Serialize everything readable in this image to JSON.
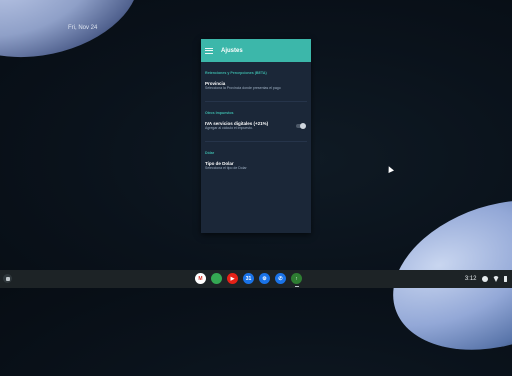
{
  "desktop": {
    "date": "Fri, Nov 24"
  },
  "app": {
    "title": "Ajustes",
    "sections": [
      {
        "header": "Retenciones y Percepciones (BETA)",
        "items": [
          {
            "title": "Provincia",
            "subtitle": "Selecciona la Provincia donde presentas el pago"
          }
        ]
      },
      {
        "header": "Otros Impuestos",
        "items": [
          {
            "title": "IVA servicios digitales (+21%)",
            "subtitle": "Agregar al cálculo el impuesto.",
            "toggle": false
          }
        ]
      },
      {
        "header": "Dólar",
        "items": [
          {
            "title": "Tipo de Dolar",
            "subtitle": "Selecciona el tipo de Dolar"
          }
        ]
      }
    ]
  },
  "shelf": {
    "time": "3:12",
    "apps": [
      {
        "name": "gmail-icon",
        "color": "#ffffff",
        "glyph": "M",
        "fg": "#d93025"
      },
      {
        "name": "chrome-icon",
        "color": "#34a853",
        "glyph": "",
        "fg": "#ffffff"
      },
      {
        "name": "youtube-icon",
        "color": "#e62117",
        "glyph": "▶",
        "fg": "#ffffff"
      },
      {
        "name": "calendar-icon",
        "color": "#1a73e8",
        "glyph": "31",
        "fg": "#ffffff"
      },
      {
        "name": "settings-icon",
        "color": "#1a73e8",
        "glyph": "⚙",
        "fg": "#ffffff"
      },
      {
        "name": "phone-icon",
        "color": "#1a73e8",
        "glyph": "✆",
        "fg": "#ffffff"
      },
      {
        "name": "calculator-app-icon",
        "color": "#2e7d32",
        "glyph": "↑",
        "fg": "#ffffff"
      }
    ]
  }
}
